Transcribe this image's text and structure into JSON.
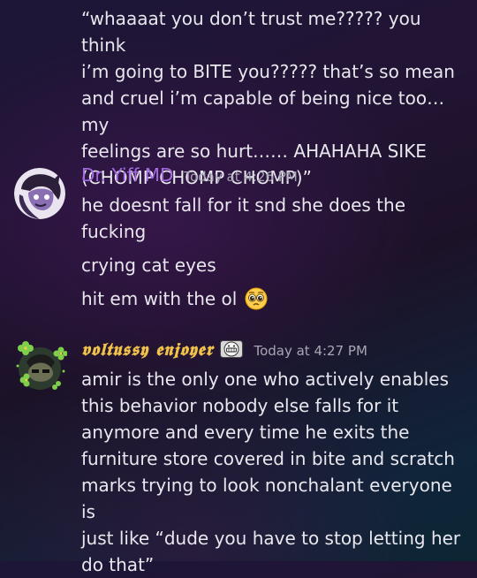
{
  "messages": {
    "quoted_text": [
      "“whaaaat you don’t trust me????? you think",
      "i’m going to BITE you????? that’s so mean",
      "and cruel i’m capable of being nice too… my",
      "feelings are so hurt…… AHAHAHA SIKE",
      "(CHOMP CHOMP CHOMP)”"
    ],
    "group1": {
      "username": "Dr. Yiff MD",
      "timestamp": "Today at 4:26 PM",
      "line1a": "he doesnt fall for it snd she does the",
      "line1b": "fucking",
      "line2": "crying cat eyes",
      "line3": "hit em with the ol",
      "emoji_icon": "pleading-face-icon"
    },
    "group2": {
      "username": "𝖛𝖔𝖑𝖙𝖚𝖘𝖘𝖞 𝖊𝖓𝖏𝖔𝖞𝖊𝖗",
      "badge_icon": "grimace-face-badge-icon",
      "timestamp": "Today at 4:27 PM",
      "lines": [
        "amir is the only one who actively enables",
        "this behavior nobody else falls for it",
        "anymore and every time he exits the",
        "furniture store covered in bite and scratch",
        "marks trying to look nonchalant everyone is",
        "just like “dude you have to stop letting her",
        "do that”"
      ]
    }
  },
  "colors": {
    "username1": "#a36be0",
    "username2": "#f1c24a",
    "text": "#e8e7ee",
    "timestamp": "#a8a6b4"
  }
}
